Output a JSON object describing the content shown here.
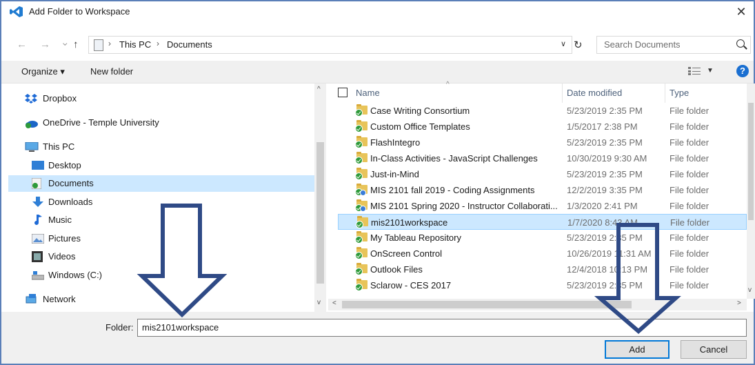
{
  "window": {
    "title": "Add Folder to Workspace",
    "close_glyph": "✕"
  },
  "nav": {
    "back_glyph": "←",
    "forward_glyph": "→",
    "recent_glyph": "⌄",
    "up_glyph": "↑",
    "breadcrumb": [
      "This PC",
      "Documents"
    ],
    "sep_glyph": "›",
    "dropdown_glyph": "∨",
    "refresh_glyph": "↻",
    "search_placeholder": "Search Documents"
  },
  "toolbar": {
    "organize_label": "Organize ▾",
    "new_folder_label": "New folder",
    "view_dd_glyph": "▼",
    "help_glyph": "?"
  },
  "sidebar": {
    "items": [
      {
        "label": "Dropbox",
        "icon": "dropbox-icon"
      },
      {
        "label": "OneDrive - Temple University",
        "icon": "onedrive-icon"
      },
      {
        "label": "This PC",
        "icon": "computer-icon"
      },
      {
        "label": "Desktop",
        "icon": "desktop-icon"
      },
      {
        "label": "Documents",
        "icon": "documents-icon",
        "selected": true
      },
      {
        "label": "Downloads",
        "icon": "download-icon"
      },
      {
        "label": "Music",
        "icon": "music-icon"
      },
      {
        "label": "Pictures",
        "icon": "pictures-icon"
      },
      {
        "label": "Videos",
        "icon": "videos-icon"
      },
      {
        "label": "Windows (C:)",
        "icon": "drive-icon"
      },
      {
        "label": "Network",
        "icon": "network-icon"
      }
    ]
  },
  "files": {
    "columns": {
      "name": "Name",
      "date": "Date modified",
      "type": "Type"
    },
    "sort_glyph": "^",
    "rows": [
      {
        "name": "Case Writing Consortium",
        "date": "5/23/2019 2:35 PM",
        "type": "File folder"
      },
      {
        "name": "Custom Office Templates",
        "date": "1/5/2017 2:38 PM",
        "type": "File folder"
      },
      {
        "name": "FlashIntegro",
        "date": "5/23/2019 2:35 PM",
        "type": "File folder"
      },
      {
        "name": "In-Class Activities - JavaScript Challenges",
        "date": "10/30/2019 9:30 AM",
        "type": "File folder"
      },
      {
        "name": "Just-in-Mind",
        "date": "5/23/2019 2:35 PM",
        "type": "File folder"
      },
      {
        "name": "MIS 2101 fall 2019 - Coding Assignments",
        "date": "12/2/2019 3:35 PM",
        "type": "File folder",
        "shared": true
      },
      {
        "name": "MIS 2101 Spring 2020 - Instructor Collaborati...",
        "date": "1/3/2020 2:41 PM",
        "type": "File folder",
        "shared": true
      },
      {
        "name": "mis2101workspace",
        "date": "1/7/2020 8:43 AM",
        "type": "File folder",
        "selected": true
      },
      {
        "name": "My Tableau Repository",
        "date": "5/23/2019 2:35 PM",
        "type": "File folder"
      },
      {
        "name": "OnScreen Control",
        "date": "10/26/2019 11:31 AM",
        "type": "File folder"
      },
      {
        "name": "Outlook Files",
        "date": "12/4/2018 10:13 PM",
        "type": "File folder"
      },
      {
        "name": "Sclarow - CES 2017",
        "date": "5/23/2019 2:35 PM",
        "type": "File folder"
      }
    ]
  },
  "scroll_glyphs": {
    "up": "^",
    "down": "v",
    "left": "<",
    "right": ">"
  },
  "bottom": {
    "folder_label": "Folder:",
    "folder_value": "mis2101workspace",
    "add_label": "Add",
    "cancel_label": "Cancel"
  },
  "colors": {
    "annotation_arrow": "#2f4a86",
    "selection": "#cce8ff",
    "accent": "#0078d7"
  }
}
